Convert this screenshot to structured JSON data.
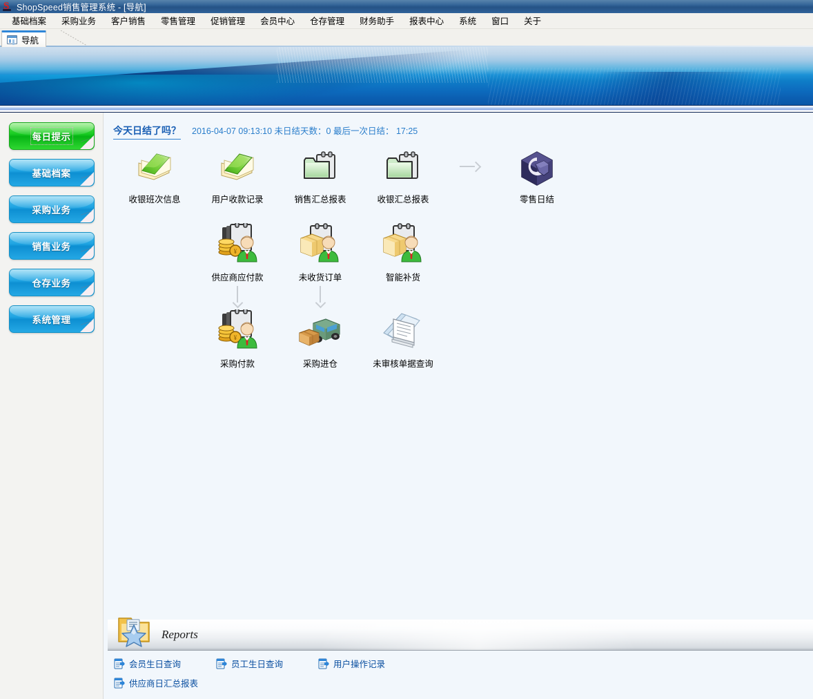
{
  "window": {
    "title": "ShopSpeed销售管理系统 - [导航]",
    "logo_icon": "shopspeed-s-logo"
  },
  "menubar": {
    "items": [
      {
        "label": "基础档案",
        "name": "menu-basic-archive"
      },
      {
        "label": "采购业务",
        "name": "menu-purchasing"
      },
      {
        "label": "客户销售",
        "name": "menu-customer-sales"
      },
      {
        "label": "零售管理",
        "name": "menu-retail"
      },
      {
        "label": "促销管理",
        "name": "menu-promotion"
      },
      {
        "label": "会员中心",
        "name": "menu-member-center"
      },
      {
        "label": "仓存管理",
        "name": "menu-warehouse"
      },
      {
        "label": "财务助手",
        "name": "menu-finance"
      },
      {
        "label": "报表中心",
        "name": "menu-reports-center"
      },
      {
        "label": "系统",
        "name": "menu-system"
      },
      {
        "label": "窗口",
        "name": "menu-window"
      },
      {
        "label": "关于",
        "name": "menu-about"
      }
    ]
  },
  "tabs": [
    {
      "label": "导航",
      "icon": "window-grid-icon",
      "active": true
    }
  ],
  "sidebar": {
    "items": [
      {
        "label": "每日提示",
        "color": "#18cc22",
        "style": "green",
        "selected": true
      },
      {
        "label": "基础档案",
        "color": "#1fa4e2",
        "style": "blue",
        "selected": false
      },
      {
        "label": "采购业务",
        "color": "#1fa4e2",
        "style": "blue",
        "selected": false
      },
      {
        "label": "销售业务",
        "color": "#1fa4e2",
        "style": "blue",
        "selected": false
      },
      {
        "label": "仓存业务",
        "color": "#1fa4e2",
        "style": "blue",
        "selected": false
      },
      {
        "label": "系统管理",
        "color": "#1fa4e2",
        "style": "blue",
        "selected": false
      }
    ]
  },
  "status": {
    "title": "今天日结了吗？",
    "text": "2016-04-07 09:13:10 未日结天数：0 最后一次日结： 17:25"
  },
  "shortcuts": {
    "row1": [
      {
        "label": "收银班次信息",
        "icon": "green-book-stack-icon"
      },
      {
        "label": "用户收款记录",
        "icon": "green-book-stack-icon"
      },
      {
        "label": "销售汇总报表",
        "icon": "clipboard-folder-icon"
      },
      {
        "label": "收银汇总报表",
        "icon": "clipboard-folder-icon"
      },
      {
        "label": "零售日结",
        "icon": "purple-cube-icon"
      }
    ],
    "row1_arrow": "arrow-right-icon",
    "row2": [
      {
        "label": "供应商应付款",
        "icon": "coins-clipboard-person-icon"
      },
      {
        "label": "未收货订单",
        "icon": "box-clipboard-person-icon"
      },
      {
        "label": "智能补货",
        "icon": "box-clipboard-person-icon"
      }
    ],
    "row3": [
      {
        "label": "采购付款",
        "icon": "coins-clipboard-person-icon"
      },
      {
        "label": "采购进仓",
        "icon": "truck-box-icon"
      },
      {
        "label": "未审核单据查询",
        "icon": "paper-stack-icon"
      }
    ],
    "down_arrow": "arrow-down-icon"
  },
  "reports": {
    "title": "Reports",
    "header_icon": "folder-star-icon",
    "links_row1": [
      {
        "label": "会员生日查询",
        "icon": "clipboard-link-icon"
      },
      {
        "label": "员工生日查询",
        "icon": "clipboard-link-icon"
      },
      {
        "label": "用户操作记录",
        "icon": "clipboard-link-icon"
      }
    ],
    "links_row2": [
      {
        "label": "供应商日汇总报表",
        "icon": "clipboard-link-icon"
      }
    ]
  },
  "colors": {
    "titlebar": "#2d5f94",
    "banner_blue": "#0f7ec8",
    "accent_link": "#0a4fa0",
    "status_blue": "#2a7ecb",
    "sidebar_bg": "#f3f3f1",
    "content_bg": "#f2f7fc"
  }
}
